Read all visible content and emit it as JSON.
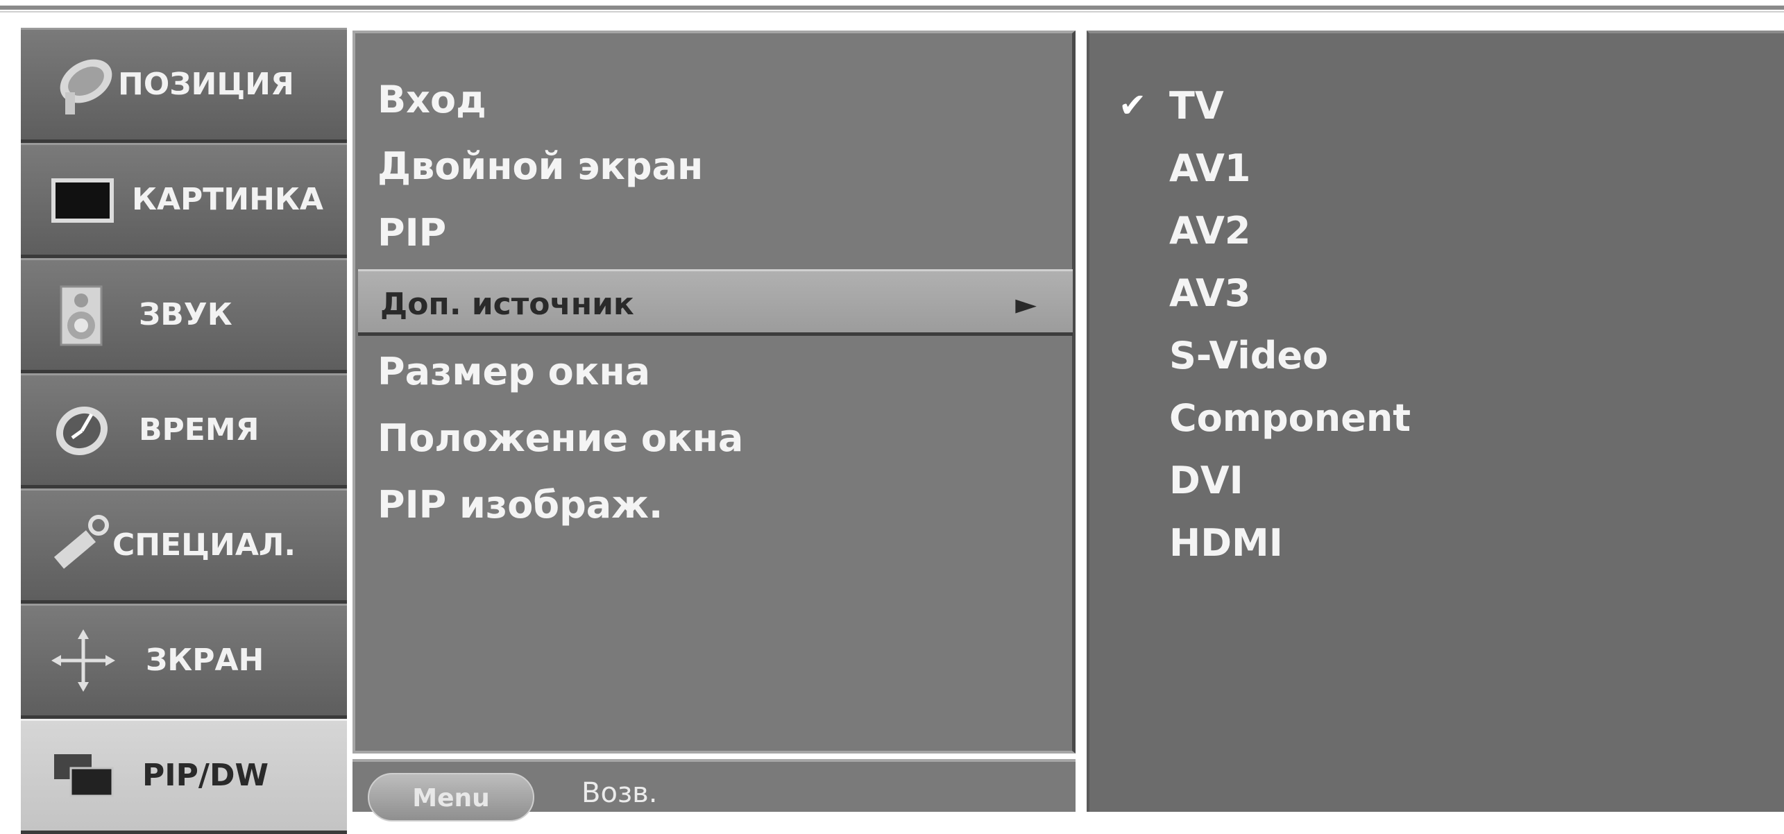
{
  "tabs": [
    {
      "label": "ПОЗИЦИЯ",
      "icon": "satellite-dish-icon"
    },
    {
      "label": "КАРТИНКА",
      "icon": "screen-icon"
    },
    {
      "label": "ЗВУК",
      "icon": "speaker-icon"
    },
    {
      "label": "ВРЕМЯ",
      "icon": "clock-icon"
    },
    {
      "label": "СПЕЦИАЛ.",
      "icon": "key-icon"
    },
    {
      "label": "ЗКРАН",
      "icon": "move-arrows-icon"
    },
    {
      "label": "PIP/DW",
      "icon": "pip-windows-icon",
      "active": true
    }
  ],
  "menu": {
    "items": [
      {
        "label": "Вход"
      },
      {
        "label": "Двойной экран"
      },
      {
        "label": "PIP"
      },
      {
        "label": "Доп. источник",
        "selected": true,
        "arrow": "►"
      },
      {
        "label": "Размер окна"
      },
      {
        "label": "Положение окна"
      },
      {
        "label": "PIP изображ."
      }
    ]
  },
  "bottom": {
    "menu_button": "Menu",
    "back_label": "Возв."
  },
  "submenu": {
    "check_glyph": "✔",
    "selected_index": 0,
    "items": [
      "TV",
      "AV1",
      "AV2",
      "AV3",
      "S-Video",
      "Component",
      "DVI",
      "HDMI"
    ]
  },
  "colors": {
    "panel": "#7a7a7a",
    "submenu_panel": "#6c6c6c",
    "highlight": "#a8a8a8",
    "active_tab": "#cccccc"
  }
}
